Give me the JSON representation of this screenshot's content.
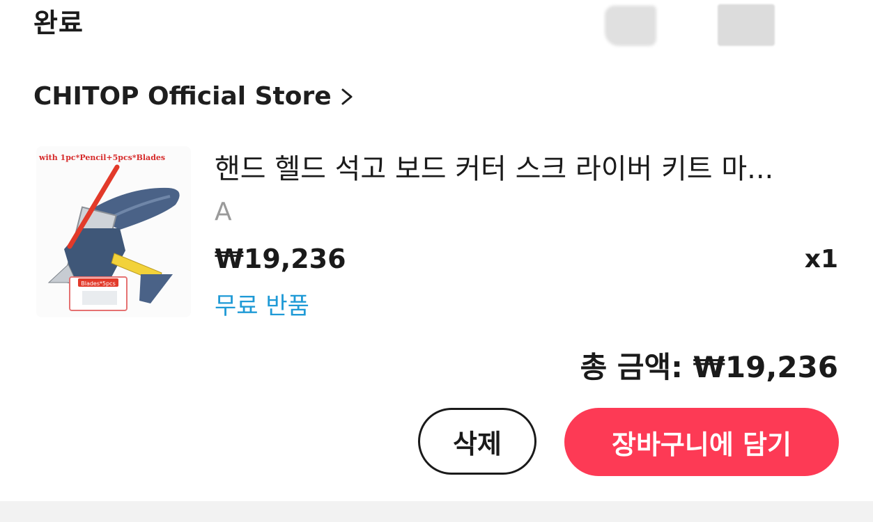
{
  "header": {
    "status_title": "완료"
  },
  "store": {
    "name": "CHITOP Official Store",
    "chevron_icon": "chevron-right-icon"
  },
  "product": {
    "image_caption": "with 1pc*Pencil+5pcs*Blades",
    "image_badge": "Blades*5pcs",
    "title": "핸드 헬드 석고 보드 커터 스크 라이버 키트 마...",
    "variant": "A",
    "price": "₩19,236",
    "quantity": "x1",
    "return_policy": "무료 반품"
  },
  "summary": {
    "total_label": "총 금액: ₩19,236"
  },
  "actions": {
    "delete_label": "삭제",
    "add_to_cart_label": "장바구니에 담기"
  },
  "colors": {
    "accent": "#fd3a55",
    "link": "#1f9ad6"
  }
}
